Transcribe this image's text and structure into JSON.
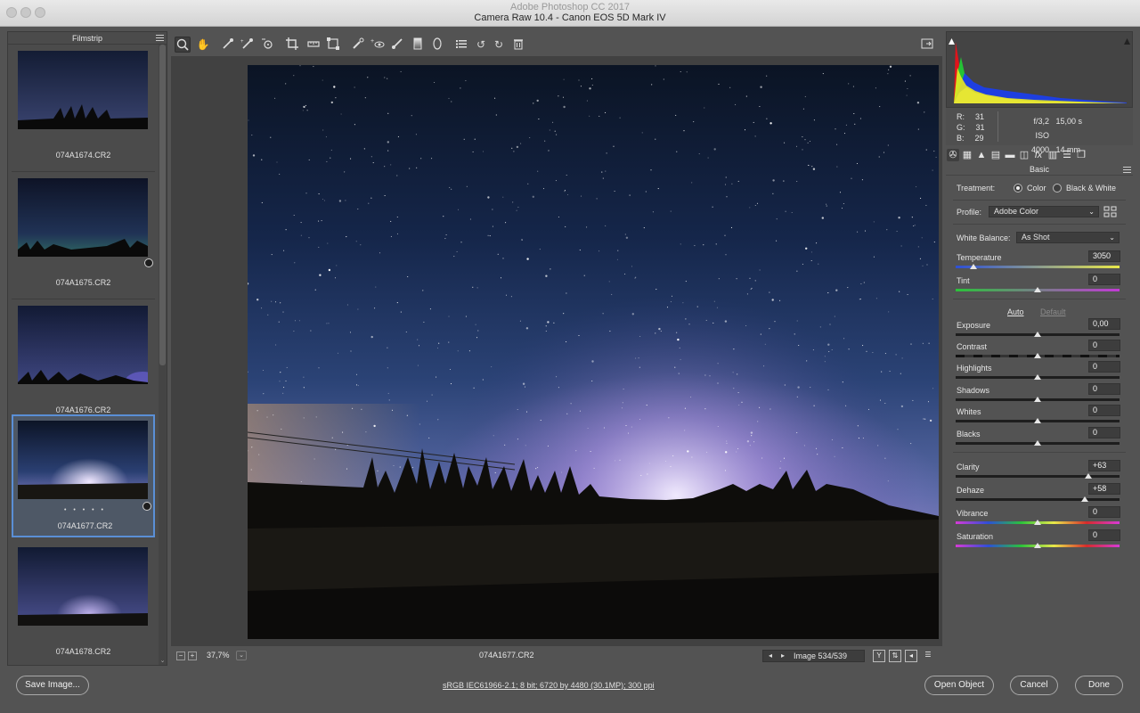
{
  "window": {
    "behind_title": "Adobe Photoshop CC 2017",
    "title": "Camera Raw 10.4  -  Canon EOS 5D Mark IV"
  },
  "filmstrip": {
    "title": "Filmstrip",
    "items": [
      {
        "name": "074A1674.CR2",
        "selected": false
      },
      {
        "name": "074A1675.CR2",
        "selected": false
      },
      {
        "name": "074A1676.CR2",
        "selected": false
      },
      {
        "name": "074A1677.CR2",
        "selected": true,
        "rating": "• • • • •"
      },
      {
        "name": "074A1678.CR2",
        "selected": false
      }
    ]
  },
  "toolbar": {
    "tools": [
      "zoom-tool",
      "hand-tool",
      "white-balance-tool",
      "color-sampler-tool",
      "targeted-adjustment-tool",
      "crop-tool",
      "straighten-tool",
      "transform-tool",
      "spot-removal-tool",
      "red-eye-tool",
      "adjustment-brush",
      "graduated-filter",
      "radial-filter",
      "preferences",
      "rotate-ccw",
      "rotate-cw",
      "trash"
    ]
  },
  "status": {
    "zoom": "37,7%",
    "filename": "074A1677.CR2",
    "image_counter": "Image 534/539"
  },
  "readout": {
    "r_label": "R:",
    "r": "31",
    "g_label": "G:",
    "g": "31",
    "b_label": "B:",
    "b": "29",
    "aperture": "f/3,2",
    "shutter": "15,00 s",
    "iso": "ISO 4000",
    "focal": "14 mm"
  },
  "basic": {
    "panel_title": "Basic",
    "treatment_label": "Treatment:",
    "color_label": "Color",
    "bw_label": "Black & White",
    "profile_label": "Profile:",
    "profile_value": "Adobe Color",
    "wb_label": "White Balance:",
    "wb_value": "As Shot",
    "auto": "Auto",
    "default": "Default",
    "sliders": [
      {
        "label": "Temperature",
        "value": "3050"
      },
      {
        "label": "Tint",
        "value": "0"
      },
      {
        "label": "Exposure",
        "value": "0,00"
      },
      {
        "label": "Contrast",
        "value": "0"
      },
      {
        "label": "Highlights",
        "value": "0"
      },
      {
        "label": "Shadows",
        "value": "0"
      },
      {
        "label": "Whites",
        "value": "0"
      },
      {
        "label": "Blacks",
        "value": "0"
      },
      {
        "label": "Clarity",
        "value": "+63"
      },
      {
        "label": "Dehaze",
        "value": "+58"
      },
      {
        "label": "Vibrance",
        "value": "0"
      },
      {
        "label": "Saturation",
        "value": "0"
      }
    ]
  },
  "footer": {
    "save": "Save Image...",
    "workflow": "sRGB IEC61966-2.1; 8 bit; 6720 by 4480 (30.1MP); 300 ppi",
    "open": "Open Object",
    "cancel": "Cancel",
    "done": "Done"
  },
  "colors": {
    "panel_bg": "#535353",
    "selection_blue": "#5a8fd6",
    "text": "#e6e6e6"
  }
}
